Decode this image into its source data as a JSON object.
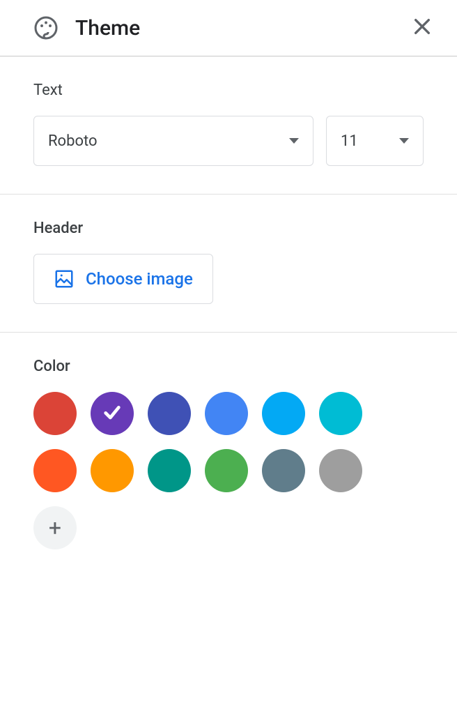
{
  "header": {
    "title": "Theme"
  },
  "sections": {
    "text": {
      "label": "Text",
      "font": "Roboto",
      "size": "11"
    },
    "headerSection": {
      "label": "Header",
      "buttonLabel": "Choose image"
    },
    "color": {
      "label": "Color",
      "swatches": [
        {
          "hex": "#db4437",
          "selected": false
        },
        {
          "hex": "#673ab7",
          "selected": true
        },
        {
          "hex": "#3f51b5",
          "selected": false
        },
        {
          "hex": "#4285f4",
          "selected": false
        },
        {
          "hex": "#03a9f4",
          "selected": false
        },
        {
          "hex": "#00bcd4",
          "selected": false
        },
        {
          "hex": "#ff5722",
          "selected": false
        },
        {
          "hex": "#ff9800",
          "selected": false
        },
        {
          "hex": "#009688",
          "selected": false
        },
        {
          "hex": "#4caf50",
          "selected": false
        },
        {
          "hex": "#607d8b",
          "selected": false
        },
        {
          "hex": "#9e9e9e",
          "selected": false
        }
      ]
    }
  }
}
